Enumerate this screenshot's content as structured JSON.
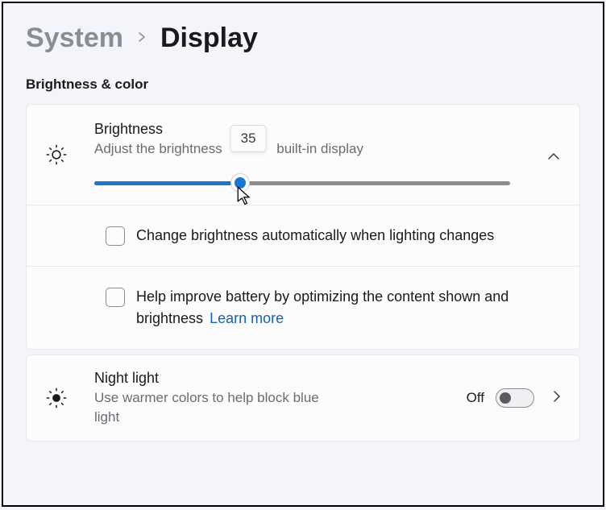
{
  "breadcrumb": {
    "parent": "System",
    "current": "Display"
  },
  "section": {
    "title": "Brightness & color"
  },
  "brightness": {
    "title": "Brightness",
    "description_pre": "Adjust the brightness",
    "description_post": "built-in display",
    "value": 35,
    "value_label": "35",
    "auto_label": "Change brightness automatically when lighting changes",
    "battery_label": "Help improve battery by optimizing the content shown and brightness",
    "learn_more": "Learn more"
  },
  "night_light": {
    "title": "Night light",
    "description": "Use warmer colors to help block blue light",
    "toggle_state": "Off",
    "enabled": false
  }
}
